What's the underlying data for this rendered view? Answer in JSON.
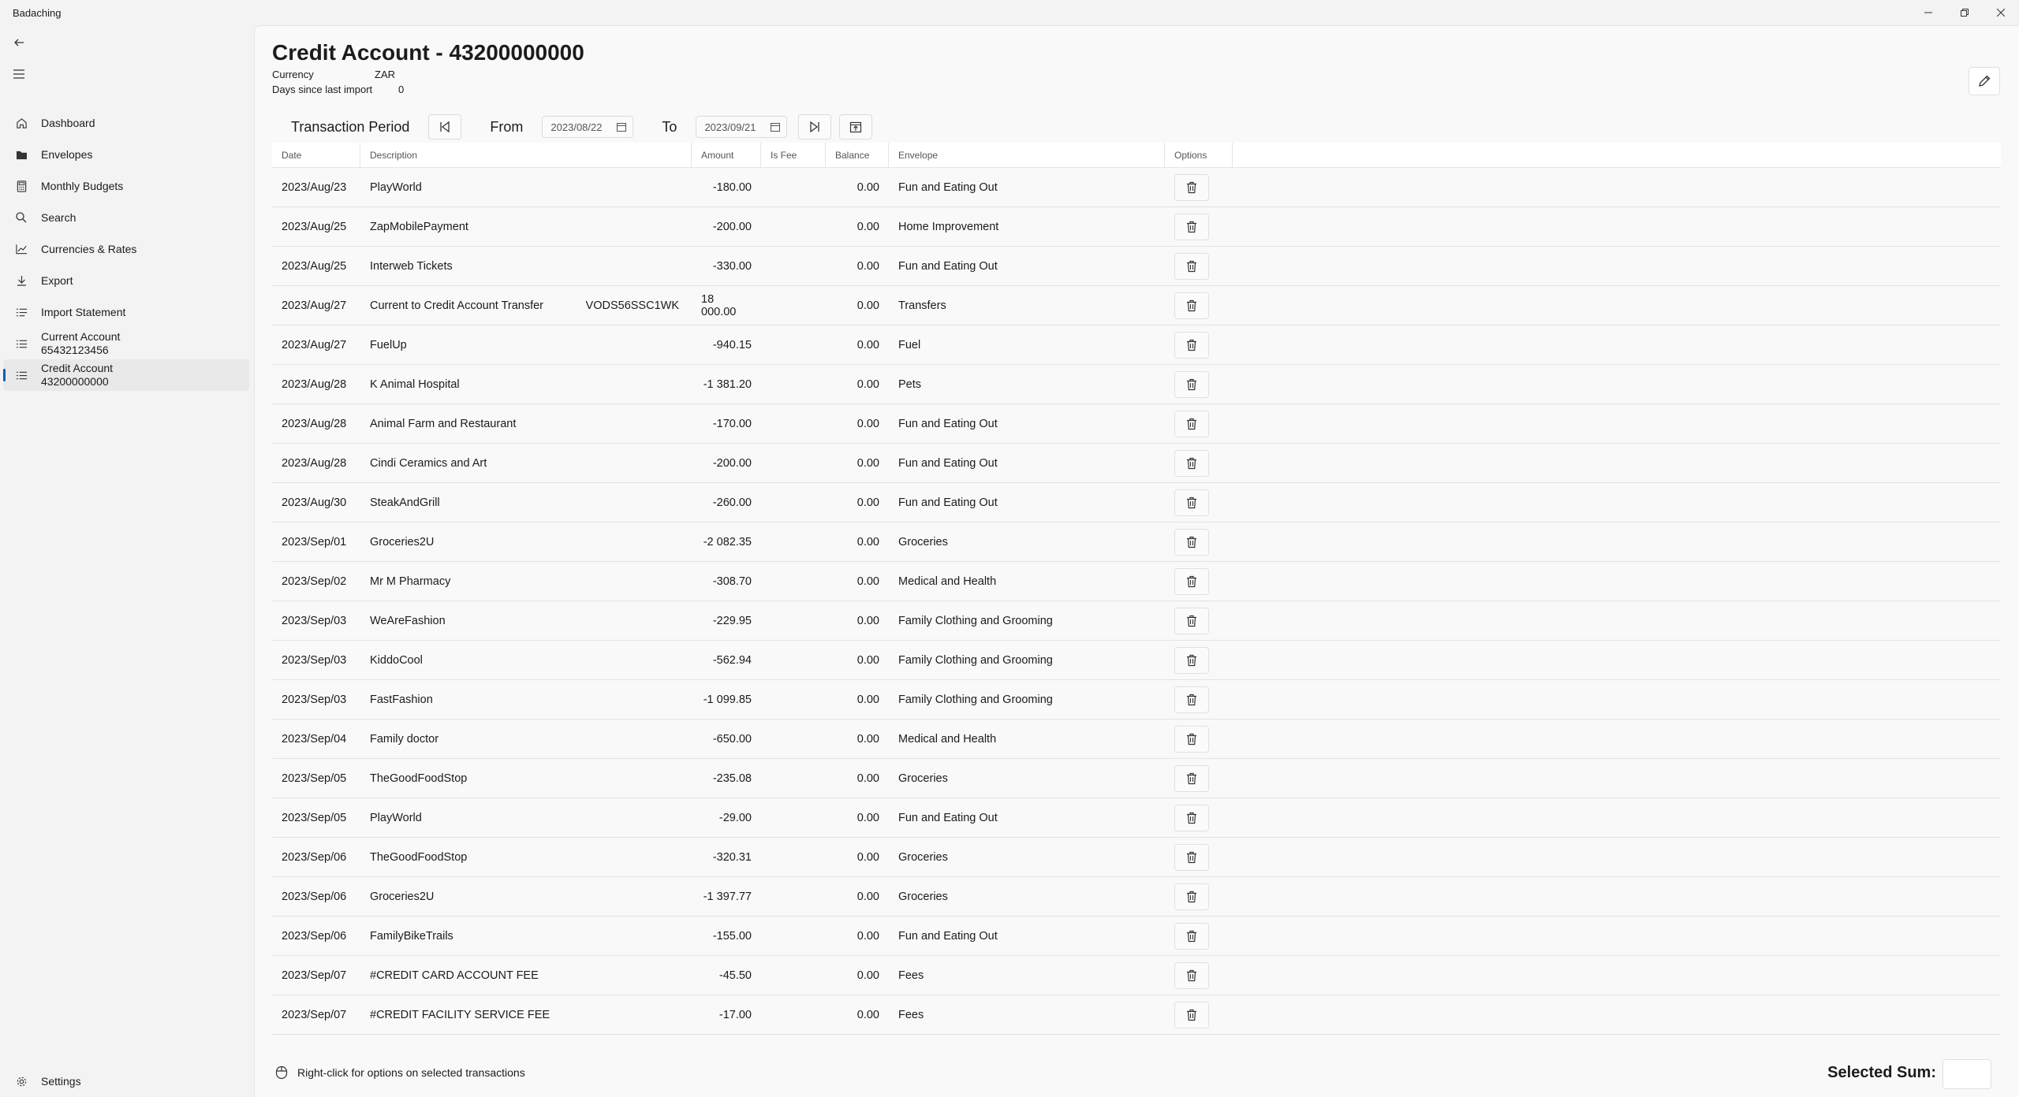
{
  "app": {
    "title": "Badaching"
  },
  "sidebar": {
    "items": [
      {
        "label": "Dashboard",
        "icon": "home-icon"
      },
      {
        "label": "Envelopes",
        "icon": "folder-icon"
      },
      {
        "label": "Monthly Budgets",
        "icon": "calculator-icon"
      },
      {
        "label": "Search",
        "icon": "search-icon"
      },
      {
        "label": "Currencies & Rates",
        "icon": "chart-icon"
      },
      {
        "label": "Export",
        "icon": "download-icon"
      },
      {
        "label": "Import Statement",
        "icon": "import-icon"
      }
    ],
    "accounts": [
      {
        "line1": "Current Account",
        "line2": "65432123456"
      },
      {
        "line1": "Credit Account",
        "line2": "43200000000"
      }
    ],
    "settings": "Settings"
  },
  "page": {
    "title": "Credit Account - 43200000000",
    "currency_label": "Currency",
    "currency_value": "ZAR",
    "days_label": "Days since last import",
    "days_value": "0"
  },
  "period": {
    "label": "Transaction Period",
    "from_label": "From",
    "from_value": "2023/08/22",
    "to_label": "To",
    "to_value": "2023/09/21"
  },
  "table": {
    "headers": {
      "date": "Date",
      "description": "Description",
      "amount": "Amount",
      "is_fee": "Is Fee",
      "balance": "Balance",
      "envelope": "Envelope",
      "options": "Options"
    },
    "rows": [
      {
        "date": "2023/Aug/23",
        "description": "PlayWorld",
        "ref": "",
        "amount": "-180.00",
        "balance": "0.00",
        "envelope": "Fun and Eating Out"
      },
      {
        "date": "2023/Aug/25",
        "description": "ZapMobilePayment",
        "ref": "",
        "amount": "-200.00",
        "balance": "0.00",
        "envelope": "Home Improvement"
      },
      {
        "date": "2023/Aug/25",
        "description": "Interweb Tickets",
        "ref": "",
        "amount": "-330.00",
        "balance": "0.00",
        "envelope": "Fun and Eating Out"
      },
      {
        "date": "2023/Aug/27",
        "description": "Current to Credit Account Transfer",
        "ref": "VODS56SSC1WK",
        "amount": "18 000.00",
        "balance": "0.00",
        "envelope": "Transfers"
      },
      {
        "date": "2023/Aug/27",
        "description": "FuelUp",
        "ref": "",
        "amount": "-940.15",
        "balance": "0.00",
        "envelope": "Fuel"
      },
      {
        "date": "2023/Aug/28",
        "description": "K Animal Hospital",
        "ref": "",
        "amount": "-1 381.20",
        "balance": "0.00",
        "envelope": "Pets"
      },
      {
        "date": "2023/Aug/28",
        "description": "Animal Farm and Restaurant",
        "ref": "",
        "amount": "-170.00",
        "balance": "0.00",
        "envelope": "Fun and Eating Out"
      },
      {
        "date": "2023/Aug/28",
        "description": "Cindi Ceramics and Art",
        "ref": "",
        "amount": "-200.00",
        "balance": "0.00",
        "envelope": "Fun and Eating Out"
      },
      {
        "date": "2023/Aug/30",
        "description": "SteakAndGrill",
        "ref": "",
        "amount": "-260.00",
        "balance": "0.00",
        "envelope": "Fun and Eating Out"
      },
      {
        "date": "2023/Sep/01",
        "description": "Groceries2U",
        "ref": "",
        "amount": "-2 082.35",
        "balance": "0.00",
        "envelope": "Groceries"
      },
      {
        "date": "2023/Sep/02",
        "description": "Mr M Pharmacy",
        "ref": "",
        "amount": "-308.70",
        "balance": "0.00",
        "envelope": "Medical and Health"
      },
      {
        "date": "2023/Sep/03",
        "description": "WeAreFashion",
        "ref": "",
        "amount": "-229.95",
        "balance": "0.00",
        "envelope": "Family Clothing and Grooming"
      },
      {
        "date": "2023/Sep/03",
        "description": "KiddoCool",
        "ref": "",
        "amount": "-562.94",
        "balance": "0.00",
        "envelope": "Family Clothing and Grooming"
      },
      {
        "date": "2023/Sep/03",
        "description": "FastFashion",
        "ref": "",
        "amount": "-1 099.85",
        "balance": "0.00",
        "envelope": "Family Clothing and Grooming"
      },
      {
        "date": "2023/Sep/04",
        "description": "Family doctor",
        "ref": "",
        "amount": "-650.00",
        "balance": "0.00",
        "envelope": "Medical and Health"
      },
      {
        "date": "2023/Sep/05",
        "description": "TheGoodFoodStop",
        "ref": "",
        "amount": "-235.08",
        "balance": "0.00",
        "envelope": "Groceries"
      },
      {
        "date": "2023/Sep/05",
        "description": "PlayWorld",
        "ref": "",
        "amount": "-29.00",
        "balance": "0.00",
        "envelope": "Fun and Eating Out"
      },
      {
        "date": "2023/Sep/06",
        "description": "TheGoodFoodStop",
        "ref": "",
        "amount": "-320.31",
        "balance": "0.00",
        "envelope": "Groceries"
      },
      {
        "date": "2023/Sep/06",
        "description": "Groceries2U",
        "ref": "",
        "amount": "-1 397.77",
        "balance": "0.00",
        "envelope": "Groceries"
      },
      {
        "date": "2023/Sep/06",
        "description": "FamilyBikeTrails",
        "ref": "",
        "amount": "-155.00",
        "balance": "0.00",
        "envelope": "Fun and Eating Out"
      },
      {
        "date": "2023/Sep/07",
        "description": "#CREDIT CARD ACCOUNT FEE",
        "ref": "",
        "amount": "-45.50",
        "balance": "0.00",
        "envelope": "Fees"
      },
      {
        "date": "2023/Sep/07",
        "description": "#CREDIT FACILITY SERVICE FEE",
        "ref": "",
        "amount": "-17.00",
        "balance": "0.00",
        "envelope": "Fees"
      }
    ]
  },
  "footer": {
    "hint": "Right-click for options on selected transactions",
    "sum_label": "Selected Sum:"
  }
}
